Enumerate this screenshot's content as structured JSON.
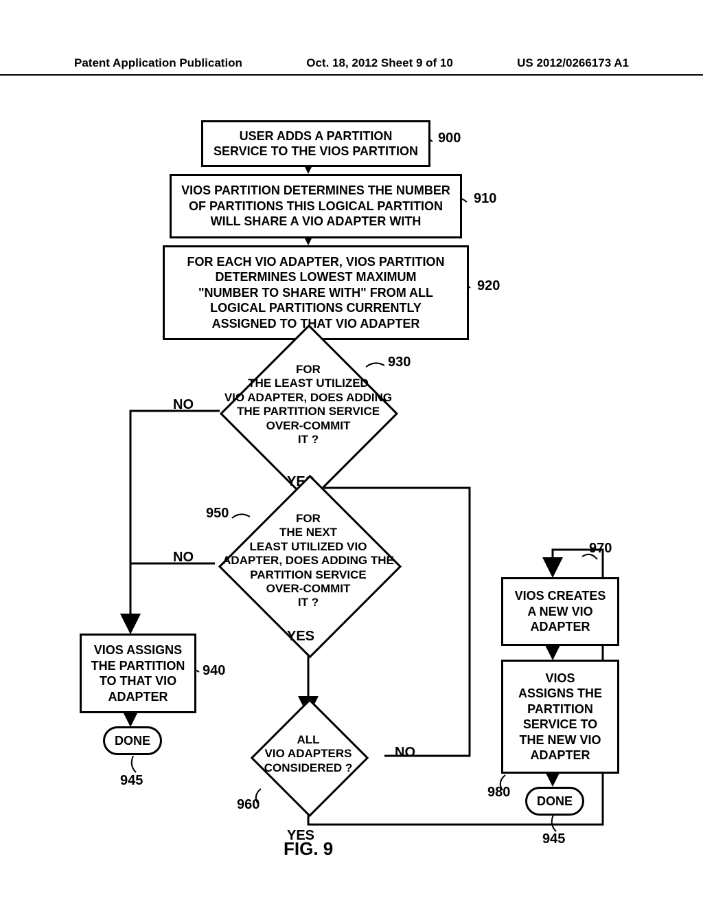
{
  "header": {
    "left": "Patent Application Publication",
    "center": "Oct. 18, 2012  Sheet 9 of 10",
    "right": "US 2012/0266173 A1"
  },
  "refs": {
    "r900": "900",
    "r910": "910",
    "r920": "920",
    "r930": "930",
    "r940": "940",
    "r945a": "945",
    "r945b": "945",
    "r950": "950",
    "r960": "960",
    "r970": "970",
    "r980": "980"
  },
  "nodes": {
    "n900": "USER ADDS A PARTITION\nSERVICE TO THE VIOS PARTITION",
    "n910": "VIOS PARTITION DETERMINES THE NUMBER\nOF PARTITIONS THIS LOGICAL PARTITION\nWILL SHARE A VIO ADAPTER WITH",
    "n920": "FOR EACH VIO ADAPTER, VIOS PARTITION\nDETERMINES LOWEST MAXIMUM\n\"NUMBER TO SHARE WITH\" FROM ALL\nLOGICAL PARTITIONS CURRENTLY\nASSIGNED TO THAT VIO ADAPTER",
    "n930": "FOR\nTHE LEAST UTILIZED\nVIO ADAPTER, DOES ADDING\nTHE PARTITION SERVICE\nOVER-COMMIT\nIT ?",
    "n950": "FOR\nTHE NEXT\nLEAST UTILIZED VIO\nADAPTER, DOES ADDING THE\nPARTITION SERVICE\nOVER-COMMIT\nIT ?",
    "n940": "VIOS ASSIGNS\nTHE PARTITION\nTO THAT VIO\nADAPTER",
    "n960": "ALL\nVIO ADAPTERS\nCONSIDERED ?",
    "n970": "VIOS CREATES\nA NEW VIO\nADAPTER",
    "n980": "VIOS\nASSIGNS THE\nPARTITION\nSERVICE TO\nTHE NEW VIO\nADAPTER",
    "done": "DONE"
  },
  "edges": {
    "no": "NO",
    "yes": "YES"
  },
  "figure": "FIG. 9"
}
